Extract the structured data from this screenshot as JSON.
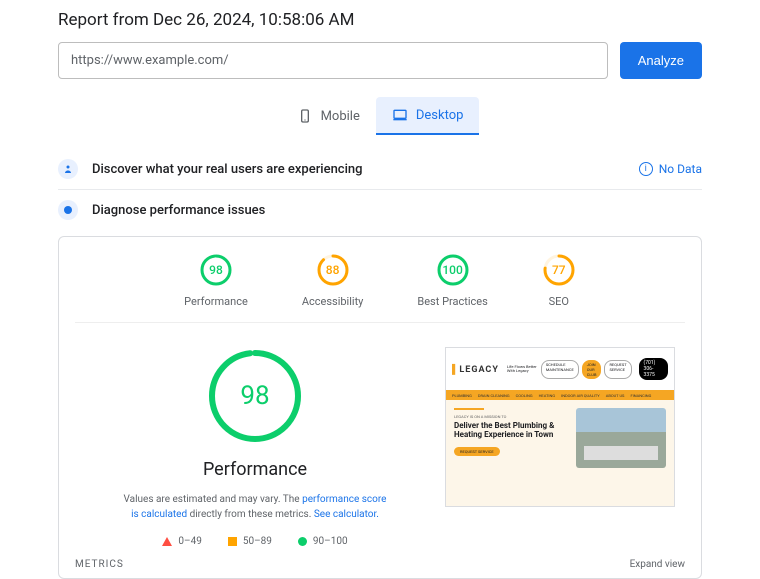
{
  "report_title": "Report from Dec 26, 2024, 10:58:06 AM",
  "url_value": "https://www.example.com/",
  "analyze_label": "Analyze",
  "tabs": {
    "mobile": "Mobile",
    "desktop": "Desktop"
  },
  "section1": {
    "title": "Discover what your real users are experiencing",
    "no_data": "No Data"
  },
  "section2": {
    "title": "Diagnose performance issues"
  },
  "scores": [
    {
      "value": 98,
      "label": "Performance",
      "color": "#0cce6b",
      "bg": "#e6f6ec",
      "pct": 98
    },
    {
      "value": 88,
      "label": "Accessibility",
      "color": "#ffa400",
      "bg": "#fff4e0",
      "pct": 88
    },
    {
      "value": 100,
      "label": "Best Practices",
      "color": "#0cce6b",
      "bg": "#e6f6ec",
      "pct": 100
    },
    {
      "value": 77,
      "label": "SEO",
      "color": "#ffa400",
      "bg": "#fff4e0",
      "pct": 77
    }
  ],
  "big_score": {
    "value": 98,
    "label": "Performance",
    "color": "#0cce6b",
    "bg": "#e6f6ec",
    "pct": 98
  },
  "desc": {
    "text1": "Values are estimated and may vary. The ",
    "link1": "performance score is calculated",
    "text2": " directly from these metrics. ",
    "link2": "See calculator."
  },
  "legend": {
    "r1": "0–49",
    "r2": "50–89",
    "r3": "90–100"
  },
  "thumbnail": {
    "logo": "LEGACY",
    "tagline": "Life Flows Better With Legacy",
    "badges": [
      "SCHEDULE MAINTENANCE",
      "JOIN OUR CLUB",
      "REQUEST SERVICE"
    ],
    "phone": "(701) 306-3375",
    "nav": [
      "PLUMBING",
      "DRAIN CLEANING",
      "COOLING",
      "HEATING",
      "INDOOR AIR QUALITY",
      "ABOUT US",
      "FINANCING"
    ],
    "mission": "LEGACY IS ON A MISSION TO",
    "headline": "Deliver the Best Plumbing & Heating Experience in Town",
    "cta": "REQUEST SERVICE"
  },
  "footer": {
    "metrics": "METRICS",
    "expand": "Expand view"
  }
}
